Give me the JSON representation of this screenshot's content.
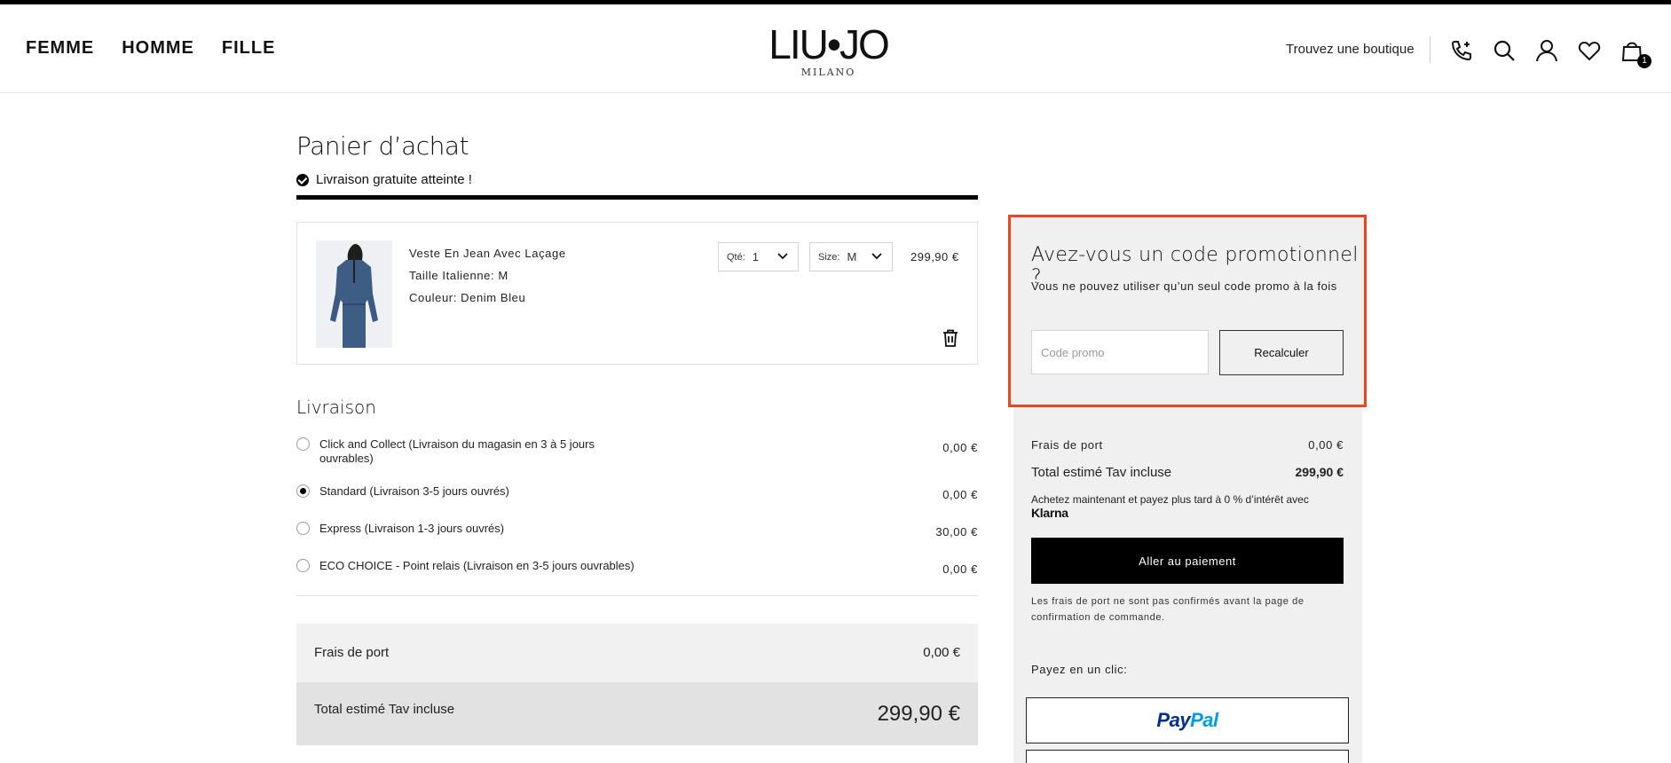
{
  "header": {
    "nav": [
      "FEMME",
      "HOMME",
      "FILLE"
    ],
    "logo_main": "LIU•JO",
    "logo_sub": "MILANO",
    "store_link": "Trouvez une boutique",
    "cart_count": "1",
    "icons": [
      "phone-icon",
      "search-icon",
      "user-icon",
      "heart-icon",
      "bag-icon"
    ]
  },
  "cart": {
    "title": "Panier d’achat",
    "free_shipping": "Livraison gratuite atteinte !",
    "item": {
      "name": "Veste En Jean Avec Laçage",
      "size_line": "Taille Italienne: M",
      "color_line": "Couleur: Denim Bleu",
      "qty_label": "Qté:",
      "qty_value": "1",
      "size_label": "Size:",
      "size_value": "M",
      "price": "299,90 €"
    }
  },
  "shipping": {
    "title": "Livraison",
    "options": [
      {
        "label": "Click and Collect (Livraison du magasin en 3 à 5 jours ouvrables)",
        "price": "0,00 €",
        "selected": false
      },
      {
        "label": "Standard (Livraison 3-5 jours ouvrés)",
        "price": "0,00 €",
        "selected": true
      },
      {
        "label": "Express (Livraison 1-3 jours ouvrés)",
        "price": "30,00 €",
        "selected": false
      },
      {
        "label": "ECO CHOICE - Point relais (Livraison en 3-5 jours ouvrables)",
        "price": "0,00 €",
        "selected": false
      }
    ]
  },
  "summary_left": {
    "shipping_label": "Frais de port",
    "shipping_value": "0,00 €",
    "total_label": "Total estimé Tav incluse",
    "total_value": "299,90 €"
  },
  "promo": {
    "title": "Avez-vous un code promotionnel ?",
    "note": "Vous ne pouvez utiliser qu’un seul code promo à la fois",
    "placeholder": "Code promo",
    "button": "Recalculer"
  },
  "summary_right": {
    "shipping_label": "Frais de port",
    "shipping_value": "0,00 €",
    "total_label": "Total estimé Tav incluse",
    "total_value": "299,90 €",
    "klarna_text": "Achetez maintenant et payez plus tard à 0 % d’intérêt avec",
    "klarna_logo": "Klarna",
    "pay_button": "Aller au paiement",
    "pay_note": "Les frais de port ne sont pas confirmés avant la page de confirmation de commande.",
    "oneclick_label": "Payez en un clic:",
    "paypal_p1": "Pay",
    "paypal_p2": "Pal"
  },
  "colors": {
    "accent_highlight": "#e8461f",
    "panel_bg": "#f0f0f0",
    "primary_button": "#000000"
  }
}
